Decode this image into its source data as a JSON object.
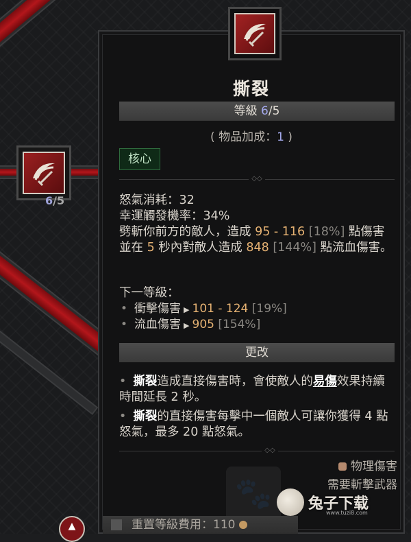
{
  "skill": {
    "name": "撕裂",
    "level_label": "等級 ",
    "level_current": "6",
    "level_max": "/5",
    "bonus_prefix": "( 物品加成：",
    "bonus_value": "1",
    "bonus_suffix": " )",
    "tag": "核心"
  },
  "node": {
    "rank_current": "6",
    "rank_max": "/5"
  },
  "stats": {
    "cost": "怒氣消耗：32",
    "lucky": "幸運觸發機率：34%"
  },
  "description": {
    "p1": "劈斬你前方的敵人，造成 ",
    "dmg_range": "95 - 116",
    "dmg_pct": " [18%]",
    "p2": " 點傷害並在 ",
    "seconds": "5",
    "p3": " 秒內對敵人造成 ",
    "bleed": "848",
    "bleed_pct": " [144%]",
    "p4": " 點流血傷害。"
  },
  "next_level": {
    "title": "下一等級：",
    "lines": [
      {
        "label": "衝擊傷害",
        "value": "101 - 124",
        "pct": " [19%]"
      },
      {
        "label": "流血傷害",
        "value": "905",
        "pct": " [154%]"
      }
    ]
  },
  "change_header": "更改",
  "modifiers": {
    "m1_a": "撕裂",
    "m1_b": "造成直接傷害時，會使敵人的",
    "m1_kw": "易傷",
    "m1_c": "效果持續時間延長 2 秒。",
    "m2_a": "撕裂",
    "m2_b": "的直接傷害每擊中一個敵人可讓你獲得 4 點怒氣，最多 20 點怒氣。"
  },
  "footer": {
    "damage_type": "物理傷害",
    "requirement": "需要斬擊武器"
  },
  "reset": {
    "label": "重置等級費用：",
    "cost": "110"
  },
  "watermark": {
    "text": "兔子下载",
    "url": "www.tuzi8.com"
  },
  "colors": {
    "accent_blue": "#a4a9ec",
    "number_orange": "#e6b273",
    "tag_green": "#2f6b3d",
    "branch_red": "#b3161b"
  }
}
